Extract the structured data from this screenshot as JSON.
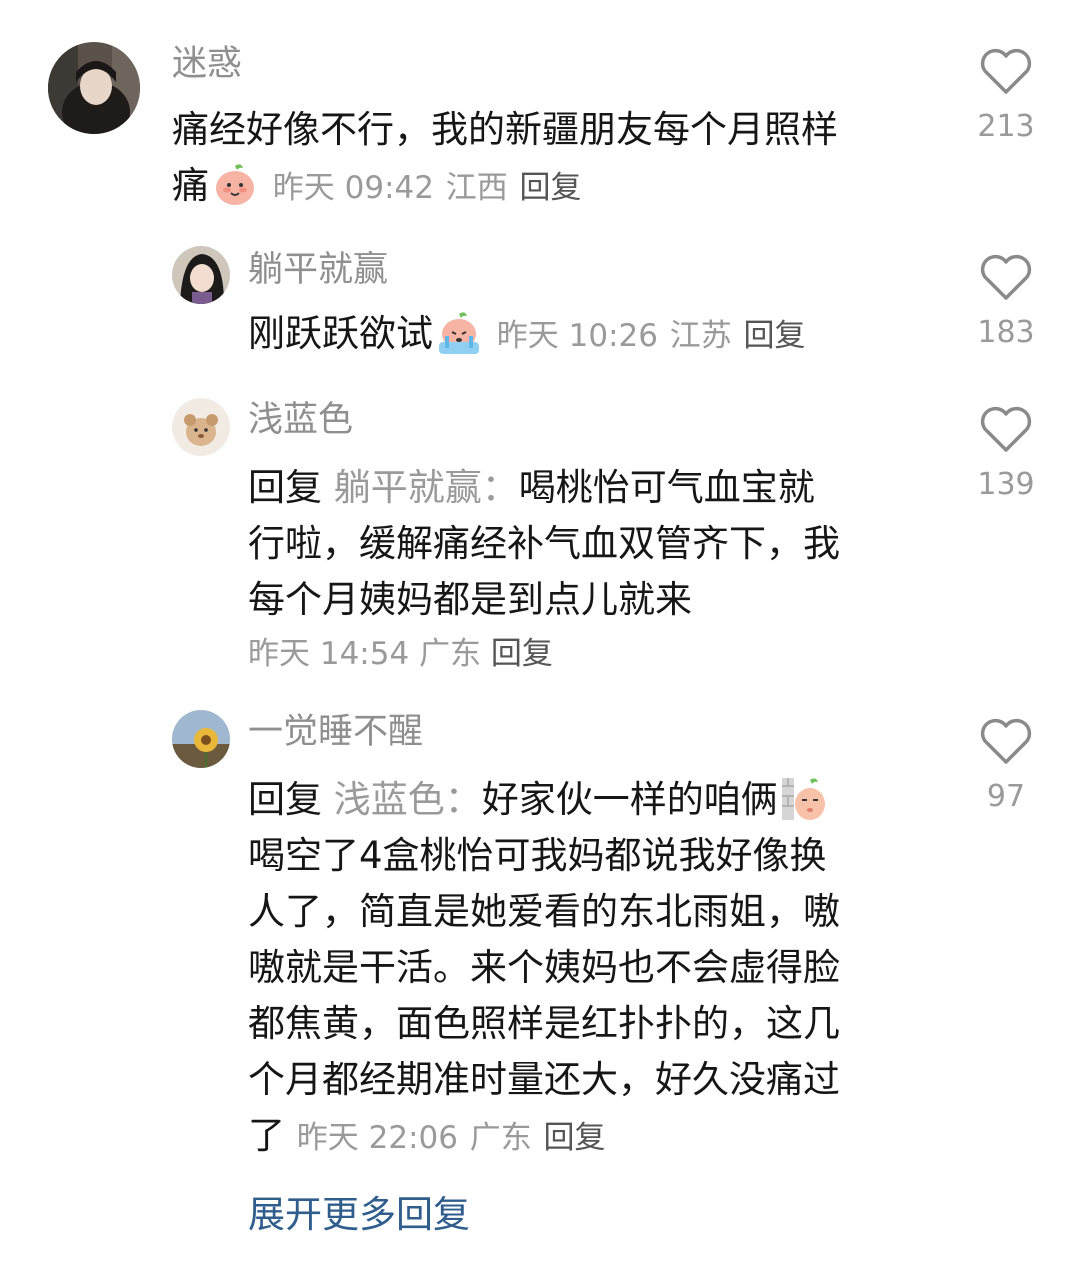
{
  "comments": [
    {
      "user": "迷惑",
      "text": "痛经好像不行，我的新疆朋友每个月照样痛",
      "text_line1": "痛经好像不行，我的新疆朋友每个月照样",
      "text_line2": "痛",
      "time": "昨天 09:42",
      "location": "江西",
      "reply_label": "回复",
      "likes": "213",
      "emoji": "smiling-peach-emoji"
    },
    {
      "user": "躺平就赢",
      "text": "刚跃跃欲试",
      "time": "昨天 10:26",
      "location": "江苏",
      "reply_label": "回复",
      "likes": "183",
      "emoji": "crying-peach-emoji"
    },
    {
      "user": "浅蓝色",
      "reply_prefix": "回复",
      "reply_to": "躺平就赢：",
      "text_line1": "喝桃怡可气血宝就",
      "text_line2": "行啦，缓解痛经补气血双管齐下，我",
      "text_line3": "每个月姨妈都是到点儿就来",
      "time": "昨天 14:54",
      "location": "广东",
      "reply_label": "回复",
      "likes": "139"
    },
    {
      "user": "一觉睡不醒",
      "reply_prefix": "回复",
      "reply_to": "浅蓝色：",
      "text_line1": "好家伙一样的咱俩",
      "text_line2": "喝空了4盒桃怡可我妈都说我好像换",
      "text_line3": "人了，简直是她爱看的东北雨姐，嗷",
      "text_line4": "嗷就是干活。来个姨妈也不会虚得脸",
      "text_line5": "都焦黄，面色照样是红扑扑的，这几",
      "text_line6": "个月都经期准时量还大，好久没痛过",
      "text_line7": "了",
      "time": "昨天 22:06",
      "location": "广东",
      "reply_label": "回复",
      "likes": "97",
      "emoji": "peeking-peach-emoji"
    }
  ],
  "expand_more": "展开更多回复",
  "colors": {
    "username": "#8f8f8f",
    "text": "#161616",
    "meta": "#9a9a9a",
    "link": "#2f5d8c",
    "heart": "#8a8a8a"
  }
}
